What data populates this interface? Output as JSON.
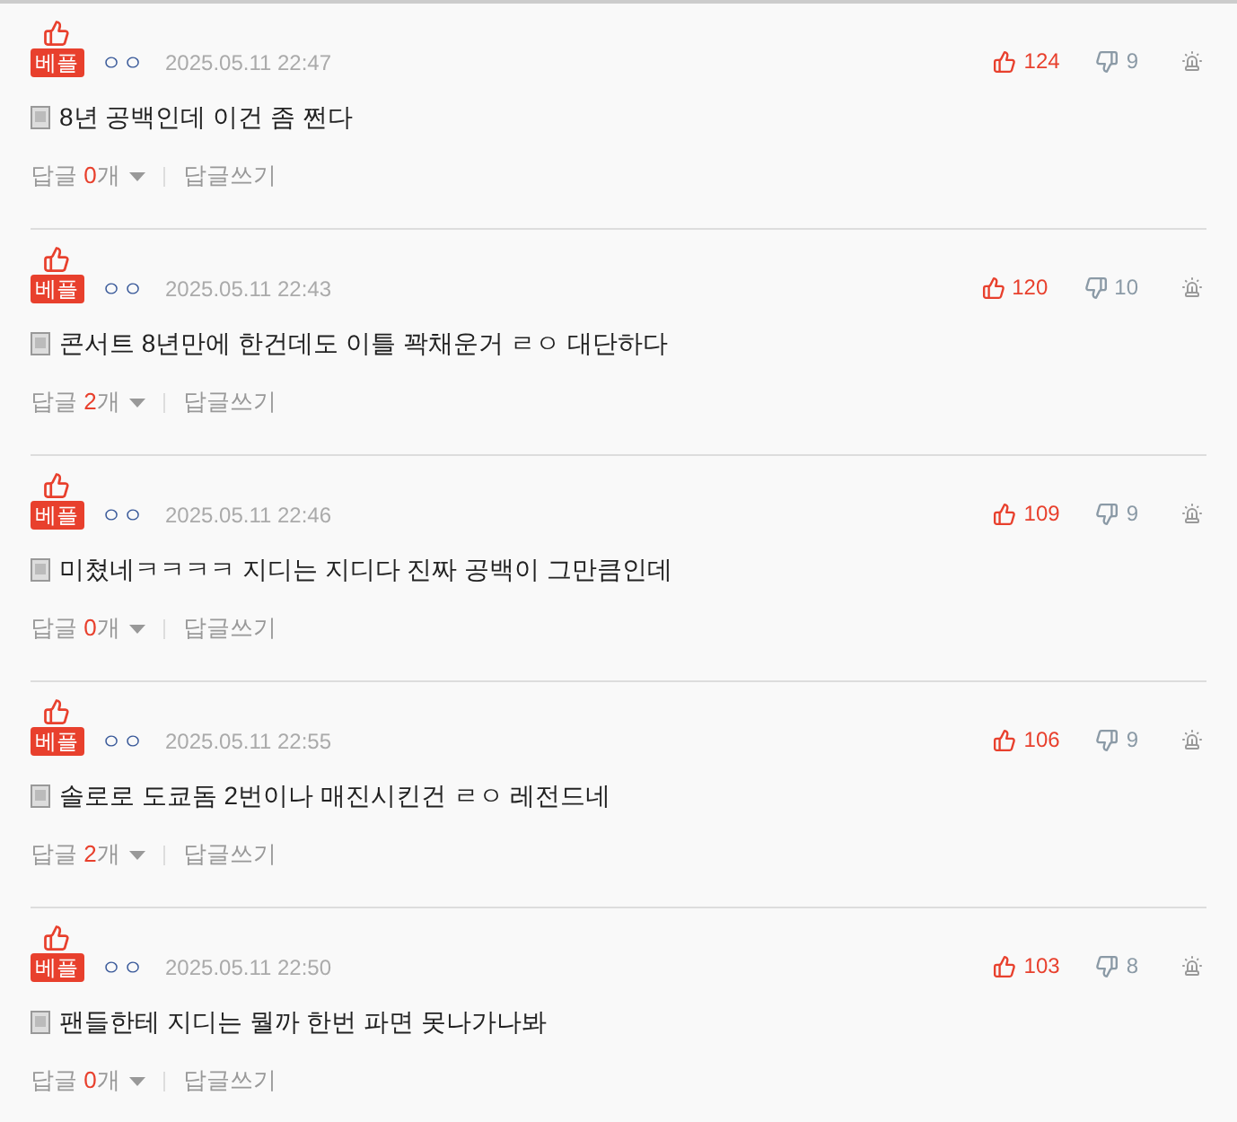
{
  "comments": [
    {
      "badge": "베플",
      "author": "ㅇㅇ",
      "date": "2025.05.11 22:47",
      "likes": "124",
      "dislikes": "9",
      "text": "8년 공백인데 이건 좀 쩐다",
      "reply_prefix": "답글 ",
      "reply_count": "0",
      "reply_suffix": "개",
      "write_reply": "답글쓰기"
    },
    {
      "badge": "베플",
      "author": "ㅇㅇ",
      "date": "2025.05.11 22:43",
      "likes": "120",
      "dislikes": "10",
      "text": "콘서트 8년만에 한건데도 이틀 꽉채운거 ㄹㅇ 대단하다",
      "reply_prefix": "답글 ",
      "reply_count": "2",
      "reply_suffix": "개",
      "write_reply": "답글쓰기"
    },
    {
      "badge": "베플",
      "author": "ㅇㅇ",
      "date": "2025.05.11 22:46",
      "likes": "109",
      "dislikes": "9",
      "text": "미쳤네ㅋㅋㅋㅋ 지디는 지디다 진짜 공백이 그만큼인데",
      "reply_prefix": "답글 ",
      "reply_count": "0",
      "reply_suffix": "개",
      "write_reply": "답글쓰기"
    },
    {
      "badge": "베플",
      "author": "ㅇㅇ",
      "date": "2025.05.11 22:55",
      "likes": "106",
      "dislikes": "9",
      "text": "솔로로 도쿄돔 2번이나 매진시킨건 ㄹㅇ 레전드네",
      "reply_prefix": "답글 ",
      "reply_count": "2",
      "reply_suffix": "개",
      "write_reply": "답글쓰기"
    },
    {
      "badge": "베플",
      "author": "ㅇㅇ",
      "date": "2025.05.11 22:50",
      "likes": "103",
      "dislikes": "8",
      "text": "팬들한테 지디는 뭘까 한번 파면 못나가나봐",
      "reply_prefix": "답글 ",
      "reply_count": "0",
      "reply_suffix": "개",
      "write_reply": "답글쓰기"
    }
  ]
}
